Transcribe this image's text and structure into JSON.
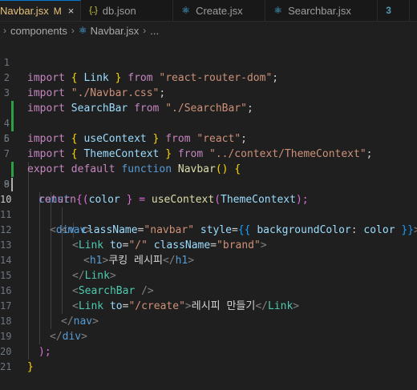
{
  "tabs": [
    {
      "label": "Navbar.jsx",
      "modified": "M",
      "close": "×",
      "icon": "react-icon",
      "active": true
    },
    {
      "label": "db.json",
      "icon": "json-icon",
      "active": false
    },
    {
      "label": "Create.jsx",
      "icon": "react-icon",
      "active": false
    },
    {
      "label": "Searchbar.jsx",
      "icon": "react-icon",
      "active": false
    },
    {
      "label": "",
      "icon": "css-icon",
      "active": false
    }
  ],
  "icons": {
    "react": "⚛",
    "json": "{..}",
    "css": "3",
    "chevron": "›",
    "close": "×"
  },
  "breadcrumb": {
    "folder": "components",
    "file": "Navbar.jsx",
    "more": "..."
  },
  "lines": [
    {
      "n": "1"
    },
    {
      "n": "2"
    },
    {
      "n": "3"
    },
    {
      "n": "4"
    },
    {
      "n": "5"
    },
    {
      "n": "6"
    },
    {
      "n": "7"
    },
    {
      "n": "8"
    },
    {
      "n": "9"
    },
    {
      "n": "10"
    },
    {
      "n": "11"
    },
    {
      "n": "12"
    },
    {
      "n": "13"
    },
    {
      "n": "14"
    },
    {
      "n": "15"
    },
    {
      "n": "16"
    },
    {
      "n": "17"
    },
    {
      "n": "18"
    },
    {
      "n": "19"
    },
    {
      "n": "20"
    },
    {
      "n": "21"
    }
  ],
  "code": {
    "l1": {
      "a": "import",
      "b": " { ",
      "c": "Link",
      "d": " } ",
      "e": "from",
      "f": " ",
      "g": "\"react-router-dom\"",
      "h": ";"
    },
    "l2": {
      "a": "import",
      "b": " ",
      "c": "\"./Navbar.css\"",
      "d": ";"
    },
    "l3": {
      "a": "import",
      "b": " ",
      "c": "SearchBar",
      "d": " ",
      "e": "from",
      "f": " ",
      "g": "\"./SearchBar\"",
      "h": ";"
    },
    "l4": {
      "a": "import",
      "b": " { ",
      "c": "useContext",
      "d": " } ",
      "e": "from",
      "f": " ",
      "g": "\"react\"",
      "h": ";"
    },
    "l5": {
      "a": "import",
      "b": " { ",
      "c": "ThemeContext",
      "d": " } ",
      "e": "from",
      "f": " ",
      "g": "\"../context/ThemeContext\"",
      "h": ";"
    },
    "l7": {
      "a": "export",
      "b": " ",
      "c": "default",
      "d": " ",
      "e": "function",
      "f": " ",
      "g": "Navbar",
      "h": "()",
      "i": " {"
    },
    "l8": {
      "a": "const",
      "b": " { ",
      "c": "color",
      "d": " } = ",
      "e": "useContext",
      "f": "(",
      "g": "ThemeContext",
      "h": ");"
    },
    "l9": {
      "a": "return",
      "b": " ("
    },
    "l10": {
      "a": "<",
      "b": "div",
      "c": " ",
      "d": "className",
      "e": "=",
      "f": "\"navbar\"",
      "g": " ",
      "h": "style",
      "i": "=",
      "j": "{{",
      "k": " ",
      "l": "backgroundColor",
      "m": ": ",
      "n": "color",
      "o": " ",
      "p": "}}",
      "q": ">"
    },
    "l11": {
      "a": "<",
      "b": "nav",
      "c": ">"
    },
    "l12": {
      "a": "<",
      "b": "Link",
      "c": " ",
      "d": "to",
      "e": "=",
      "f": "\"/\"",
      "g": " ",
      "h": "className",
      "i": "=",
      "j": "\"brand\"",
      "k": ">"
    },
    "l13": {
      "a": "<",
      "b": "h1",
      "c": ">",
      "d": "쿠킹 레시피",
      "e": "</",
      "f": "h1",
      "g": ">"
    },
    "l14": {
      "a": "</",
      "b": "Link",
      "c": ">"
    },
    "l15": {
      "a": "<",
      "b": "SearchBar",
      "c": " />"
    },
    "l16": {
      "a": "<",
      "b": "Link",
      "c": " ",
      "d": "to",
      "e": "=",
      "f": "\"/create\"",
      "g": ">",
      "h": "레시피 만들기",
      "i": "</",
      "j": "Link",
      "k": ">"
    },
    "l17": {
      "a": "</",
      "b": "nav",
      "c": ">"
    },
    "l18": {
      "a": "</",
      "b": "div",
      "c": ">"
    },
    "l19": {
      "a": ");"
    },
    "l20": {
      "a": "}"
    }
  },
  "colors": {
    "accent": "#0078d4",
    "modified": "#e5c07b",
    "gitAdded": "#2ea043",
    "background": "#1f1f1f"
  }
}
